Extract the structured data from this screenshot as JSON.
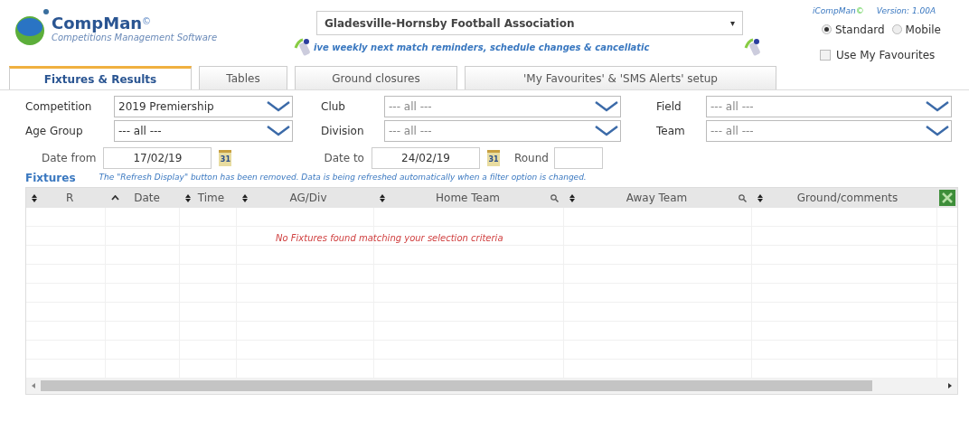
{
  "logo": {
    "name": "CompMan",
    "mark": "©",
    "tagline": "Competitions Management Software"
  },
  "association": {
    "value": "Gladesville-Hornsby Football Association",
    "caret": "▾"
  },
  "ticker": "ive weekly next match reminders, schedule changes & cancellatic",
  "version": {
    "app": "iCompMan",
    "mark": "©",
    "label": "Version: 1.00A"
  },
  "modes": [
    {
      "label": "Standard",
      "selected": true
    },
    {
      "label": "Mobile",
      "selected": false
    }
  ],
  "favourites": {
    "label": "Use My Favourites",
    "checked": false
  },
  "tabs": [
    {
      "label": "Fixtures & Results",
      "selected": true
    },
    {
      "label": "Tables",
      "selected": false
    },
    {
      "label": "Ground closures",
      "selected": false
    },
    {
      "label": "'My Favourites' & 'SMS Alerts' setup",
      "selected": false
    }
  ],
  "filters": [
    {
      "kind": "select",
      "label": "Competition",
      "value": "2019 Premiership"
    },
    {
      "kind": "select",
      "label": "Club",
      "value": "--- all ---"
    },
    {
      "kind": "select",
      "label": "Field",
      "value": "--- all ---"
    },
    {
      "kind": "select",
      "label": "Age Group",
      "value": "--- all ---"
    },
    {
      "kind": "select",
      "label": "Division",
      "value": "--- all ---"
    },
    {
      "kind": "select",
      "label": "Team",
      "value": "--- all ---"
    }
  ],
  "dates": [
    {
      "kind": "date",
      "label": "Date from",
      "value": "17/02/19",
      "icon_text": "31"
    },
    {
      "kind": "date",
      "label": "Date to",
      "value": "24/02/19",
      "icon_text": "31"
    },
    {
      "kind": "text",
      "label": "Round"
    }
  ],
  "fixtures": {
    "title": "Fixtures",
    "note": "The \"Refresh Display\" button has been removed. Data is being refreshed automatically when a filter option is changed.",
    "columns": [
      {
        "label": "R",
        "sorted": false,
        "search": false
      },
      {
        "label": "Date",
        "sorted": true,
        "search": false
      },
      {
        "label": "Time",
        "sorted": false,
        "search": false
      },
      {
        "label": "AG/Div",
        "sorted": false,
        "search": false
      },
      {
        "label": "Home Team",
        "sorted": false,
        "search": true
      },
      {
        "label": "Away Team",
        "sorted": false,
        "search": true
      },
      {
        "label": "Ground/comments",
        "sorted": false,
        "search": false
      }
    ],
    "empty_message": "No Fixtures found matching your selection criteria"
  }
}
